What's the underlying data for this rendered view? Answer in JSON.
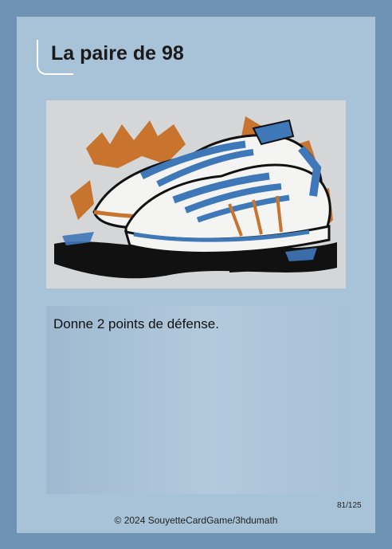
{
  "card": {
    "title": "La paire de 98",
    "ability": "Donne 2 points de défense.",
    "number": "81/125",
    "copyright": "© 2024 SouyetteCardGame/3hdumath"
  },
  "illustration": {
    "subject": "sneakers-illustration",
    "colors": {
      "blue": "#3f78b8",
      "orange": "#c9742e",
      "ink": "#111111",
      "white": "#f4f4f2"
    }
  }
}
